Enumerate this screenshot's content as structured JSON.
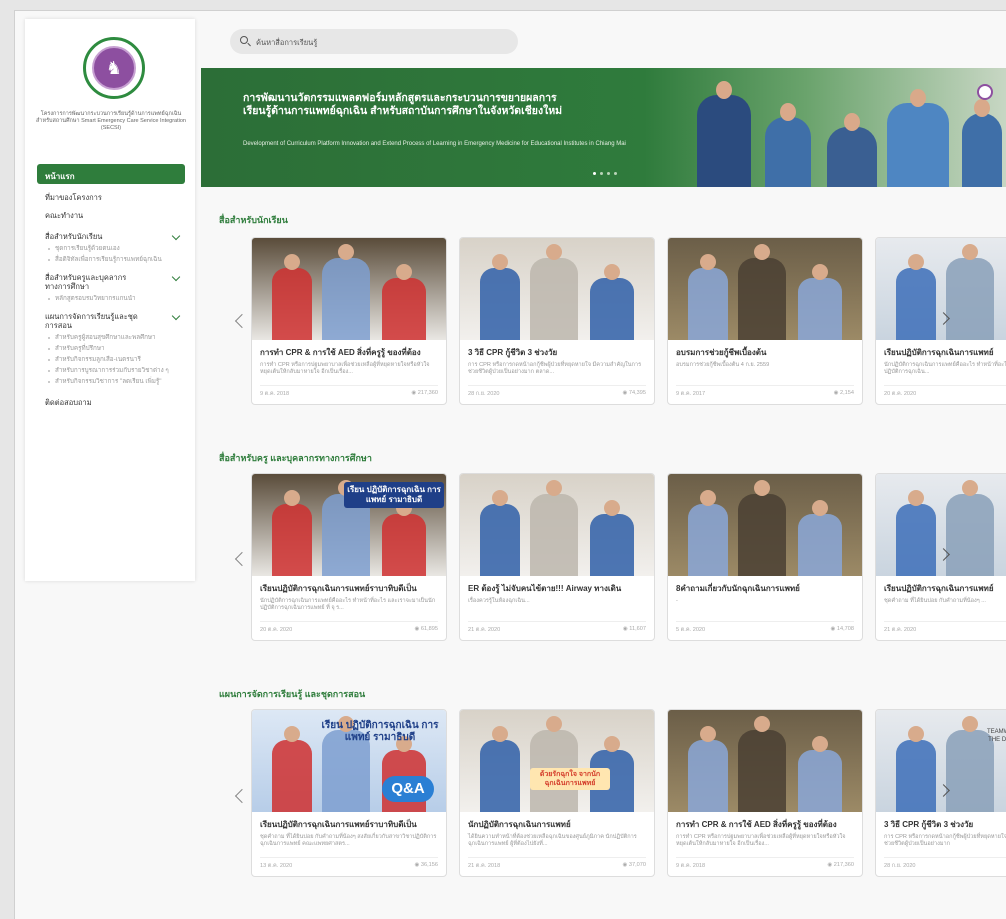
{
  "sidebar": {
    "org_text": "โครงการการพัฒนากระบวนการเรียนรู้ด้านการแพทย์ฉุกเฉินสำหรับสถานศึกษา Smart Emergency Care Service Integration (SECSI)",
    "items": [
      {
        "label": "หน้าแรก",
        "active": true
      },
      {
        "label": "ที่มาของโครงการ"
      },
      {
        "label": "คณะทำงาน"
      },
      {
        "label": "สื่อสำหรับนักเรียน",
        "expandable": true,
        "subs": [
          "ชุดการเรียนรู้ด้วยตนเอง",
          "สื่อดิจิทัลเพื่อการเรียนรู้การแพทย์ฉุกเฉิน"
        ]
      },
      {
        "label": "สื่อสำหรับครูและบุคลากรทางการศึกษา",
        "expandable": true,
        "subs": [
          "หลักสูตรอบรมวิทยากรแกนนำ"
        ]
      },
      {
        "label": "แผนการจัดการเรียนรู้และชุดการสอน",
        "expandable": true,
        "subs": [
          "สำหรับครูผู้สอนสุขศึกษาและพลศึกษา",
          "สำหรับครูที่ปรึกษา",
          "สำหรับกิจกรรมลูกเสือ-เนตรนารี",
          "สำหรับการบูรณาการร่วมกับรายวิชาต่าง ๆ",
          "สำหรับกิจกรรมวิชาการ \"ลดเรียน เพิ่มรู้\""
        ]
      },
      {
        "label": "ติดต่อสอบถาม"
      }
    ]
  },
  "search": {
    "placeholder": "ค้นหาสื่อการเรียนรู้"
  },
  "banner": {
    "title": "การพัฒนานวัตกรรมแพลตฟอร์มหลักสูตรและกระบวนการขยายผลการเรียนรู้ด้านการแพทย์ฉุกเฉิน สำหรับสถาบันการศึกษาในจังหวัดเชียงใหม่",
    "subtitle": "Development of Curriculum Platform Innovation and Extend Process of Learning in Emergency Medicine for Educational Institutes in Chiang Mai",
    "slides": 4,
    "active_slide": 1
  },
  "sections": [
    {
      "title": "สื่อสำหรับนักเรียน",
      "cards": [
        {
          "title": "การทำ CPR & การใช้ AED สิ่งที่ครูรู้ ของที่ต้อง",
          "desc": "การทำ CPR หรือการปฐมพยาบาลเพื่อช่วยเหลือผู้ที่หยุดหายใจหรือหัวใจหยุดเต้นให้กลับมาหายใจ อีกเป็นเรื่อง...",
          "date": "9 ต.ค. 2018",
          "views": "217,360"
        },
        {
          "title": "3 วิธี CPR กู้ชีวิต 3 ช่วงวัย",
          "desc": "การ CPR หรือการกดหน้าอกกู้ชีพผู้ป่วยที่หยุดหายใจ มีความสำคัญในการช่วยชีวิตผู้ป่วยเป็นอย่างมาก ตลาด...",
          "date": "28 ก.ย. 2020",
          "views": "74,395"
        },
        {
          "title": "อบรมการช่วยกู้ชีพเบื้องต้น",
          "desc": "อบรมการช่วยกู้ชีพเบื้องต้น 4 ก.ย. 2559",
          "date": "9 ต.ค. 2017",
          "views": "2,154"
        },
        {
          "title": "เรียนปฏิบัติการฉุกเฉินการแพทย์",
          "desc": "นักปฏิบัติการฉุกเฉินการแพทย์คืออะไร ทำหน้าที่อะไร และเราจะมาเป็นนักปฏิบัติการฉุกเฉิน...",
          "date": "20 ต.ค. 2020",
          "views": ""
        }
      ]
    },
    {
      "title": "สื่อสำหรับครู และบุคลากรทางการศึกษา",
      "cards": [
        {
          "title": "เรียนปฏิบัติการฉุกเฉินการแพทย์ราบาทิบดีเป็น",
          "desc": "นักปฏิบัติการฉุกเฉินการแพทย์คืออะไร ทำหน้าที่อะไร และเราจะมาเป็นนักปฏิบัติการฉุกเฉินการแพทย์ ที่ จุ ร...",
          "date": "20 ต.ค. 2020",
          "views": "61,895"
        },
        {
          "title": "ER ต้องรู้ ไม่จับคนไข้ตาย!!! Airway ทางเดิน",
          "desc": "เรื่องควรรู้ในห้องฉุกเฉิน...",
          "date": "21 ต.ค. 2020",
          "views": "11,607"
        },
        {
          "title": "8คำถามเกี่ยวกับนักฉุกเฉินการแพทย์",
          "desc": "-",
          "date": "5 ต.ค. 2020",
          "views": "14,708"
        },
        {
          "title": "เรียนปฏิบัติการฉุกเฉินการแพทย์",
          "desc": "ชุดคำถาม ที่ได้ยินบ่อย กับคำถามที่น้องๆ ...",
          "date": "21 ต.ค. 2020",
          "views": ""
        }
      ]
    },
    {
      "title": "แผนการจัดการเรียนรู้ และชุดการสอน",
      "cards": [
        {
          "title": "เรียนปฏิบัติการฉุกเฉินการแพทย์ราบาทิบดีเป็น",
          "desc": "ชุดคำถาม ที่ได้ยินบ่อย กับคำถามที่น้องๆ สงสัยเกี่ยวกับสาขาวิชาปฏิบัติการฉุกเฉินการแพทย์ คณะแพทยศาสตร...",
          "date": "13 ต.ค. 2020",
          "views": "36,156"
        },
        {
          "title": "นักปฏิบัติการฉุกเฉินการแพทย์",
          "desc": "ได้ยินความทำหน้าที่ต้องช่วยเหลือฉุกเฉินของศูนย์ภูมิภาค นักปฏิบัติการฉุกเฉินการแพทย์ ผู้ที่ต้องไปยังที่...",
          "date": "21 ต.ค. 2018",
          "views": "37,070"
        },
        {
          "title": "การทำ CPR & การใช้ AED สิ่งที่ครูรู้ ของที่ต้อง",
          "desc": "การทำ CPR หรือการปฐมพยาบาลเพื่อช่วยเหลือผู้ที่หยุดหายใจหรือหัวใจหยุดเต้นให้กลับมาหายใจ อีกเป็นเรื่อง...",
          "date": "9 ต.ค. 2018",
          "views": "217,360"
        },
        {
          "title": "3 วิธี CPR กู้ชีวิต 3 ช่วงวัย",
          "desc": "การ CPR หรือการกดหน้าอกกู้ชีพผู้ป่วยที่หยุดหายใจ มีความสำคัญในการช่วยชีวิตผู้ป่วยเป็นอย่างมาก",
          "date": "28 ก.ย. 2020",
          "views": ""
        }
      ]
    }
  ],
  "thumb_texts": {
    "t2_0": "เรียน ปฏิบัติการฉุกเฉิน การแพทย์ รามาธิบดี",
    "t3_0a": "เรียน ปฏิบัติการฉุกเฉิน การแพทย์ รามาธิบดี",
    "t3_0b": "Q&A",
    "t3_1": "ด้วยรักฉุกใจ จากนักฉุกเฉินการแพทย์",
    "t3_3": "TEAMWORK MAKES THE DREAM WORK"
  },
  "colors": {
    "brand": "#2f7d3c",
    "accent": "#8d4fa0"
  }
}
